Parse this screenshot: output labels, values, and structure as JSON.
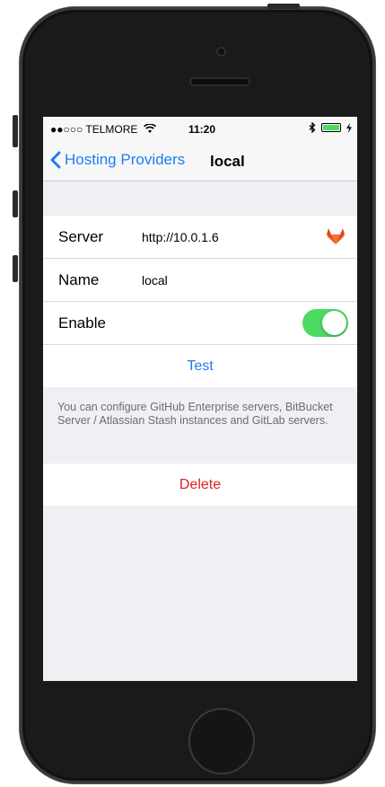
{
  "status_bar": {
    "carrier": "●●○○○ TELMORE",
    "wifi_icon": "wifi-icon",
    "time": "11:20",
    "bluetooth_icon": "bluetooth-icon",
    "battery_icon": "battery-icon",
    "charging_icon": "charging-icon"
  },
  "nav": {
    "back_label": "Hosting Providers",
    "title": "local"
  },
  "form": {
    "server_label": "Server",
    "server_value": "http://10.0.1.6",
    "server_icon": "gitlab-icon",
    "name_label": "Name",
    "name_value": "local",
    "enable_label": "Enable",
    "enable_on": true,
    "test_label": "Test"
  },
  "note": "You can configure GitHub Enterprise servers, BitBucket Server / Atlassian Stash instances and GitLab servers.",
  "delete_label": "Delete",
  "colors": {
    "accent": "#1b7ef5",
    "toggle_on": "#4cd964",
    "destructive": "#e02020",
    "background": "#efeff4"
  }
}
